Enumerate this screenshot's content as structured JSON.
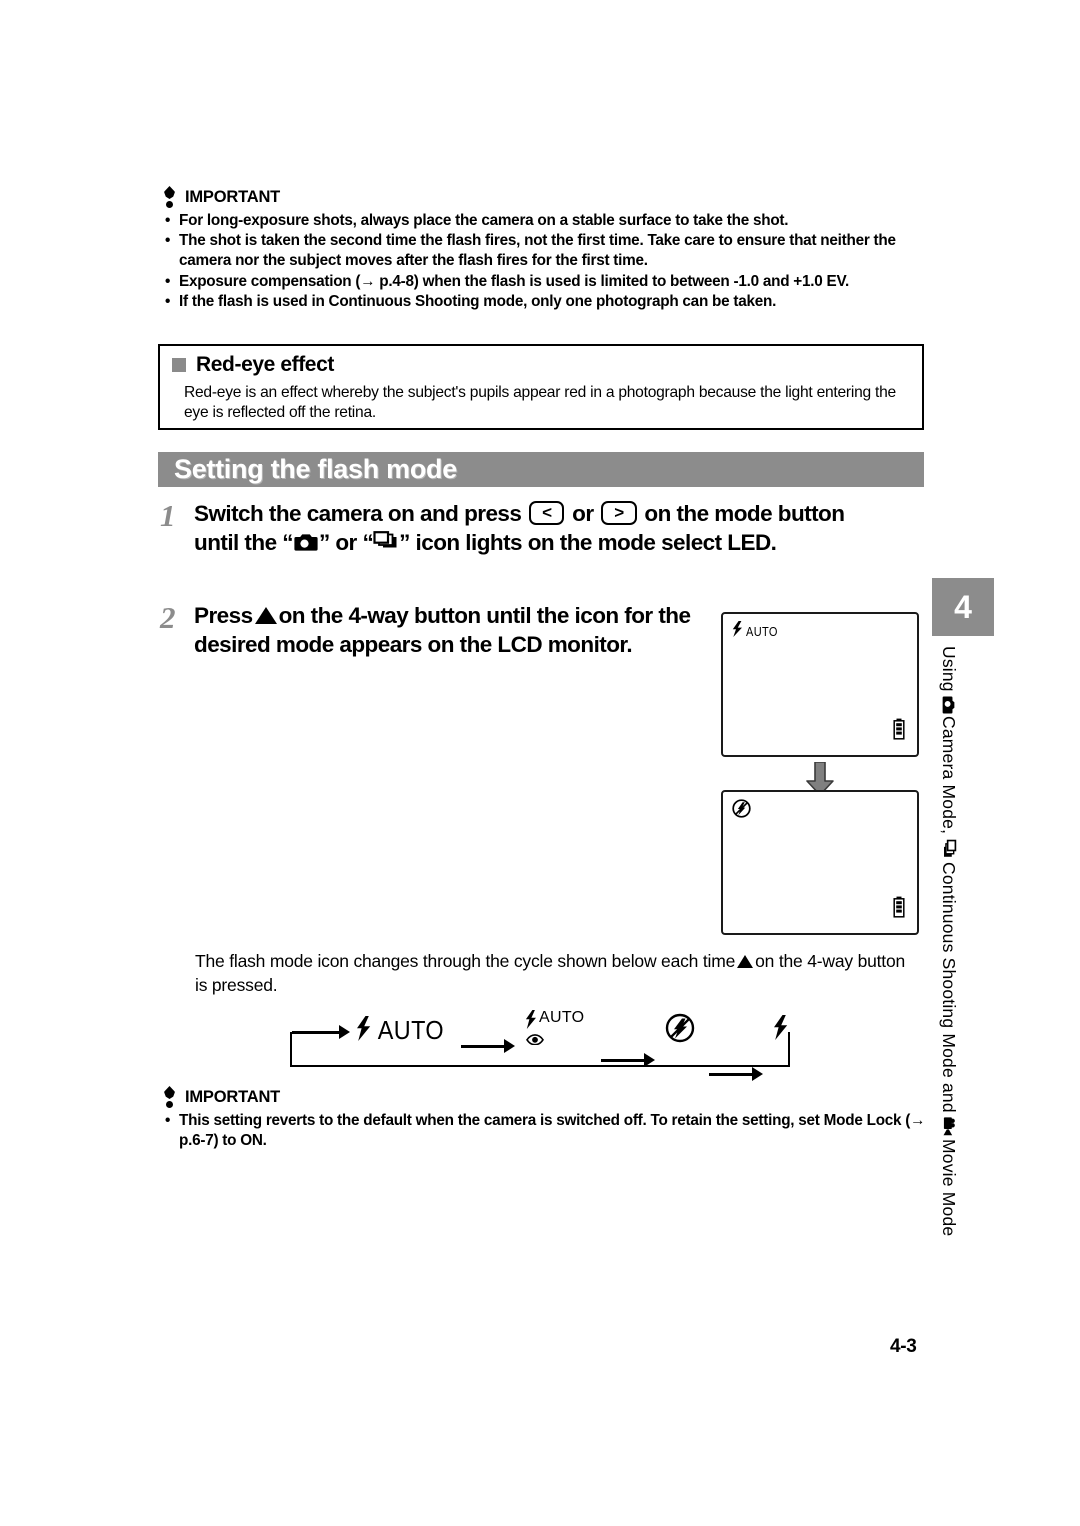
{
  "page": {
    "number": "4-3"
  },
  "important_top": {
    "title": "IMPORTANT",
    "icon": "exclamation-icon",
    "bullets": [
      "For long-exposure shots, always place the camera on a stable surface to take the shot.",
      "The shot is taken the second time the flash fires, not the first time. Take care to ensure that neither the camera nor the subject moves after the flash fires for the first time.",
      "Exposure compensation (→ p.4-8) when the flash is used is limited to between -1.0 and +1.0 EV.",
      "If the flash is used in Continuous Shooting mode, only one photograph can be taken."
    ]
  },
  "redeye": {
    "bullet_icon": "square-bullet-icon",
    "title": "Red-eye effect",
    "body": "Red-eye is an effect whereby the subject's pupils appear red in a photograph because the light entering the eye is reflected off the retina."
  },
  "section": {
    "heading": "Setting the flash mode",
    "bar_color": "#8c8c8c"
  },
  "steps": [
    {
      "number": "1",
      "text_part1": "Switch the camera on and press",
      "key_left": "<",
      "text_or": "or",
      "key_right": ">",
      "text_part2": "on the mode button until the “",
      "icon1": "camera-mode-icon",
      "text_part3": "” or “",
      "icon2": "continuous-shooting-icon",
      "text_part4": "” icon lights on the mode select LED."
    },
    {
      "number": "2",
      "text_part1": "Press",
      "icon1": "triangle-up-icon",
      "text_part2": "on the 4-way button until the icon for the desired mode appears on the LCD monitor."
    }
  ],
  "lcd_screens": [
    {
      "name": "lcd-before",
      "flash_icon": "flash-bolt-icon",
      "flash_label": "AUTO",
      "battery_icon": "battery-icon"
    },
    {
      "name": "lcd-after",
      "flash_icon": "flash-off-icon",
      "flash_label": "",
      "battery_icon": "battery-icon"
    }
  ],
  "transition_arrow": "down-arrow-icon",
  "cycle": {
    "caption_part1": "The flash mode icon changes through the cycle shown below each time",
    "caption_icon": "triangle-up-icon",
    "caption_part2": "on the 4-way button is pressed.",
    "items": [
      {
        "name": "flash-auto",
        "icon": "flash-bolt-icon",
        "label": "AUTO",
        "style": "bolt-auto"
      },
      {
        "name": "flash-auto-redeye",
        "icon": "flash-bolt-redeye-icon",
        "label": "AUTO",
        "style": "bolt-auto-eye"
      },
      {
        "name": "flash-off",
        "icon": "flash-off-icon",
        "label": "",
        "style": "circle-slash"
      },
      {
        "name": "flash-forced-on",
        "icon": "flash-bolt-icon",
        "label": "",
        "style": "bolt"
      }
    ]
  },
  "important_bottom": {
    "title": "IMPORTANT",
    "icon": "exclamation-icon",
    "bullets": [
      "This setting reverts to the default when the camera is switched off. To retain the setting, set Mode Lock (→ p.6-7) to ON."
    ]
  },
  "side_tab": {
    "chapter_number": "4",
    "vertical_text_1": "Using",
    "vertical_icon_1": "camera-mode-icon",
    "vertical_text_2": "Camera Mode,",
    "vertical_icon_2": "continuous-shooting-icon",
    "vertical_text_3": "Continuous Shooting Mode and",
    "vertical_icon_3": "movie-camera-icon",
    "vertical_text_4": "Movie Mode"
  }
}
